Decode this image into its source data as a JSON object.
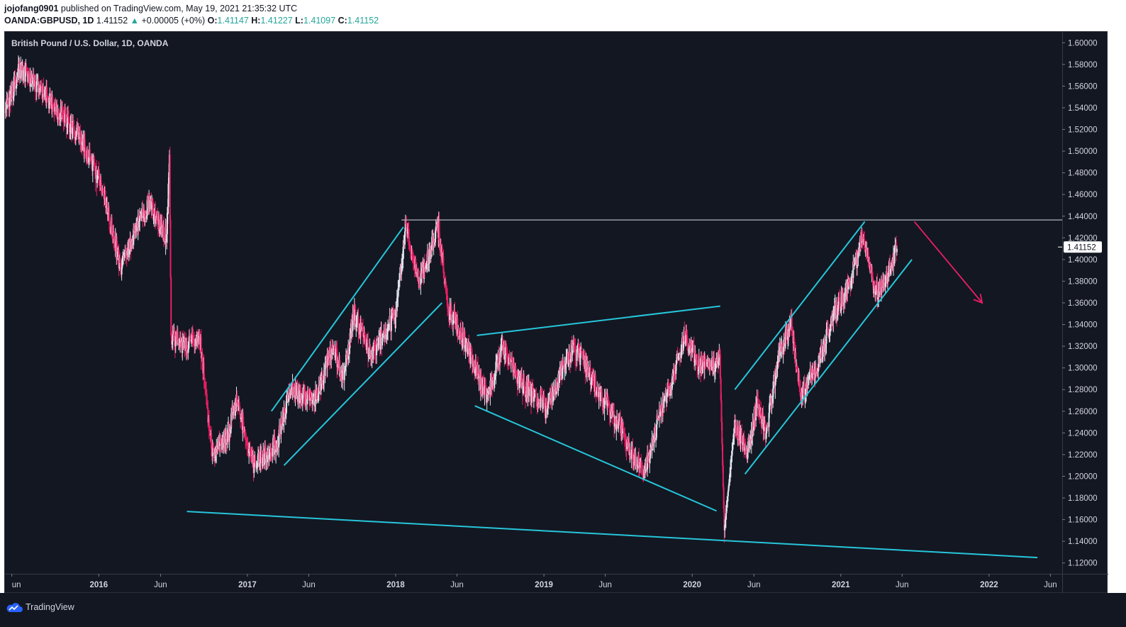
{
  "header": {
    "author": "jojofang0901",
    "published": "published on TradingView.com, May 19, 2021 21:35:32 UTC",
    "symbol": "OANDA:GBPUSD, 1D",
    "last": "1.41152",
    "change_arrow": "▲",
    "change": "+0.00005 (+0%)",
    "o_label": "O:",
    "o_value": "1.41147",
    "h_label": "H:",
    "h_value": "1.41227",
    "l_label": "L:",
    "l_value": "1.41097",
    "c_label": "C:",
    "c_value": "1.41152"
  },
  "chart_title": "British Pound / U.S. Dollar, 1D, OANDA",
  "footer": {
    "brand": "TradingView",
    "logo_icon": "tradingview-cloud-icon"
  },
  "colors": {
    "background": "#131722",
    "up_candle": "#e0e3eb",
    "down_candle": "#e91e63",
    "trendline": "#26c6da",
    "resistance": "#b2b5be",
    "arrow": "#e91e63",
    "price_tag_bg": "#ffffff"
  },
  "chart_data": {
    "type": "candlestick",
    "xlim": [
      "2015-05-15",
      "2022-06-30"
    ],
    "ylim": [
      1.11,
      1.61
    ],
    "y_ticks": [
      "1.12000",
      "1.14000",
      "1.16000",
      "1.18000",
      "1.20000",
      "1.22000",
      "1.24000",
      "1.26000",
      "1.28000",
      "1.30000",
      "1.32000",
      "1.34000",
      "1.36000",
      "1.38000",
      "1.40000",
      "1.42000",
      "1.44000",
      "1.46000",
      "1.48000",
      "1.50000",
      "1.52000",
      "1.54000",
      "1.56000",
      "1.58000",
      "1.60000"
    ],
    "x_ticks": [
      {
        "label": "un",
        "date": "2015-06-01",
        "bold": false
      },
      {
        "label": "2016",
        "date": "2016-01-01",
        "bold": true
      },
      {
        "label": "Jun",
        "date": "2016-06-01",
        "bold": false
      },
      {
        "label": "2017",
        "date": "2017-01-01",
        "bold": true
      },
      {
        "label": "Jun",
        "date": "2017-06-01",
        "bold": false
      },
      {
        "label": "2018",
        "date": "2018-01-01",
        "bold": true
      },
      {
        "label": "Jun",
        "date": "2018-06-01",
        "bold": false
      },
      {
        "label": "2019",
        "date": "2019-01-01",
        "bold": true
      },
      {
        "label": "Jun",
        "date": "2019-06-01",
        "bold": false
      },
      {
        "label": "2020",
        "date": "2020-01-01",
        "bold": true
      },
      {
        "label": "Jun",
        "date": "2020-06-01",
        "bold": false
      },
      {
        "label": "2021",
        "date": "2021-01-01",
        "bold": true
      },
      {
        "label": "Jun",
        "date": "2021-06-01",
        "bold": false
      },
      {
        "label": "2022",
        "date": "2022-01-01",
        "bold": true
      },
      {
        "label": "Jun",
        "date": "2022-06-01",
        "bold": false
      }
    ],
    "last_price": 1.41152,
    "last_price_label": "1.41152",
    "price_path": [
      [
        "2015-05-15",
        1.535
      ],
      [
        "2015-06-20",
        1.575
      ],
      [
        "2015-08-15",
        1.555
      ],
      [
        "2015-09-15",
        1.54
      ],
      [
        "2015-10-15",
        1.53
      ],
      [
        "2015-11-25",
        1.505
      ],
      [
        "2015-12-31",
        1.475
      ],
      [
        "2016-02-01",
        1.43
      ],
      [
        "2016-02-25",
        1.39
      ],
      [
        "2016-04-01",
        1.43
      ],
      [
        "2016-05-05",
        1.45
      ],
      [
        "2016-06-15",
        1.42
      ],
      [
        "2016-06-23",
        1.49
      ],
      [
        "2016-06-27",
        1.33
      ],
      [
        "2016-08-01",
        1.32
      ],
      [
        "2016-09-05",
        1.33
      ],
      [
        "2016-10-07",
        1.22
      ],
      [
        "2016-11-15",
        1.24
      ],
      [
        "2016-12-05",
        1.27
      ],
      [
        "2017-01-16",
        1.21
      ],
      [
        "2017-03-15",
        1.23
      ],
      [
        "2017-04-15",
        1.28
      ],
      [
        "2017-06-15",
        1.27
      ],
      [
        "2017-08-01",
        1.32
      ],
      [
        "2017-08-25",
        1.29
      ],
      [
        "2017-09-20",
        1.35
      ],
      [
        "2017-11-01",
        1.31
      ],
      [
        "2017-12-31",
        1.35
      ],
      [
        "2018-01-25",
        1.43
      ],
      [
        "2018-03-01",
        1.38
      ],
      [
        "2018-04-17",
        1.43
      ],
      [
        "2018-05-10",
        1.355
      ],
      [
        "2018-06-15",
        1.33
      ],
      [
        "2018-08-15",
        1.27
      ],
      [
        "2018-09-20",
        1.32
      ],
      [
        "2018-11-15",
        1.28
      ],
      [
        "2018-12-31",
        1.27
      ],
      [
        "2019-01-03",
        1.26
      ],
      [
        "2019-03-15",
        1.32
      ],
      [
        "2019-05-15",
        1.28
      ],
      [
        "2019-07-15",
        1.24
      ],
      [
        "2019-09-03",
        1.2
      ],
      [
        "2019-10-15",
        1.26
      ],
      [
        "2019-11-15",
        1.29
      ],
      [
        "2019-12-13",
        1.33
      ],
      [
        "2020-01-15",
        1.305
      ],
      [
        "2020-02-20",
        1.3
      ],
      [
        "2020-03-09",
        1.31
      ],
      [
        "2020-03-20",
        1.15
      ],
      [
        "2020-04-15",
        1.25
      ],
      [
        "2020-05-15",
        1.22
      ],
      [
        "2020-06-10",
        1.27
      ],
      [
        "2020-07-01",
        1.24
      ],
      [
        "2020-08-01",
        1.31
      ],
      [
        "2020-09-01",
        1.34
      ],
      [
        "2020-09-25",
        1.275
      ],
      [
        "2020-11-01",
        1.3
      ],
      [
        "2020-12-15",
        1.35
      ],
      [
        "2021-01-15",
        1.37
      ],
      [
        "2021-02-24",
        1.42
      ],
      [
        "2021-03-25",
        1.37
      ],
      [
        "2021-04-15",
        1.375
      ],
      [
        "2021-05-19",
        1.41152
      ]
    ],
    "annotations": {
      "resistance": {
        "from": "2018-01-15",
        "to": "2022-06-30",
        "price": 1.4365
      },
      "lines": [
        {
          "name": "long-term-support",
          "from": [
            "2016-08-05",
            1.1675
          ],
          "to": [
            "2022-04-30",
            1.125
          ]
        },
        {
          "name": "channel-2017-upper",
          "from": [
            "2017-03-01",
            1.26
          ],
          "to": [
            "2018-01-20",
            1.43
          ]
        },
        {
          "name": "channel-2017-lower",
          "from": [
            "2017-04-01",
            1.21
          ],
          "to": [
            "2018-04-25",
            1.36
          ]
        },
        {
          "name": "wedge-upper",
          "from": [
            "2018-07-20",
            1.33
          ],
          "to": [
            "2020-03-10",
            1.357
          ]
        },
        {
          "name": "wedge-lower",
          "from": [
            "2018-07-15",
            1.265
          ],
          "to": [
            "2020-03-01",
            1.168
          ]
        },
        {
          "name": "channel-2020-upper",
          "from": [
            "2020-04-15",
            1.28
          ],
          "to": [
            "2021-03-01",
            1.435
          ]
        },
        {
          "name": "channel-2020-lower",
          "from": [
            "2020-05-10",
            1.202
          ],
          "to": [
            "2021-06-25",
            1.4
          ]
        }
      ],
      "arrow": {
        "from": [
          "2021-07-01",
          1.435
        ],
        "to": [
          "2021-12-15",
          1.36
        ]
      }
    }
  }
}
